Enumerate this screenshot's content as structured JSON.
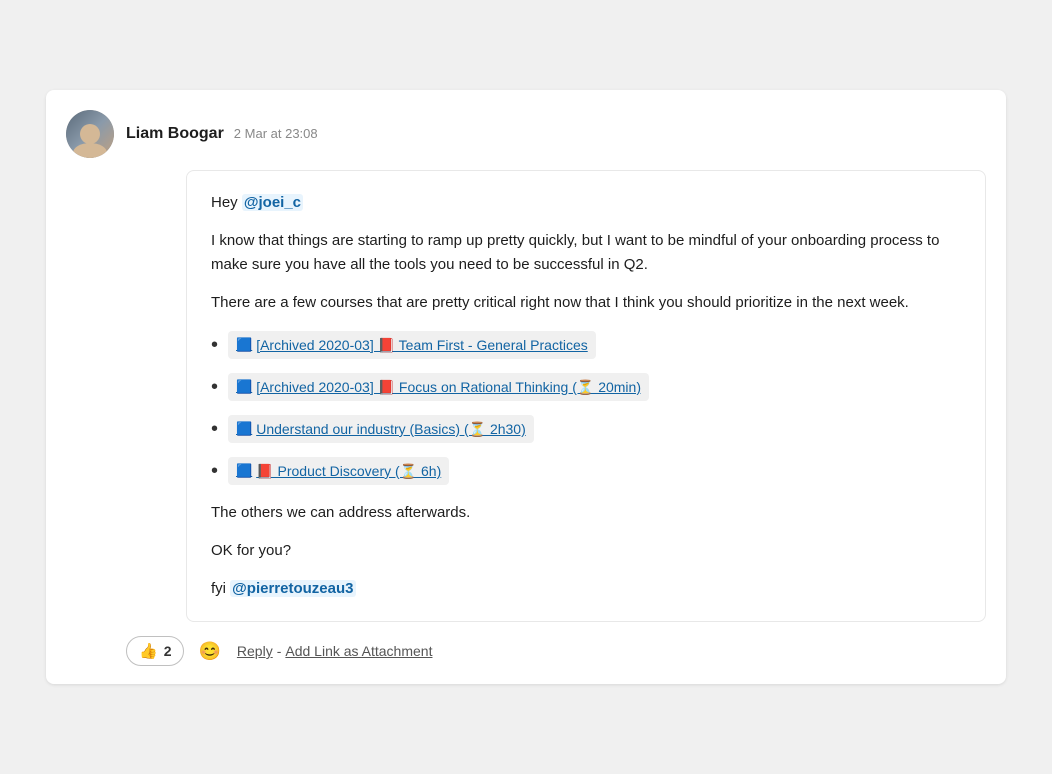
{
  "message": {
    "author": "Liam Boogar",
    "timestamp": "2 Mar at 23:08",
    "avatar_alt": "Liam Boogar avatar",
    "paragraphs": {
      "greeting": "Hey",
      "mention_joei": "@joei_c",
      "para1": "I know that things are starting to ramp up pretty quickly, but I want to be mindful of your onboarding process to make sure you have all the tools you need to be successful in Q2.",
      "para2": "There are a few courses that are pretty critical right now that I think you should prioritize in the next week.",
      "para3": "The others we can address afterwards.",
      "para4": "OK for you?",
      "fyi_label": "fyi",
      "mention_pierre": "@pierretouzeau3"
    },
    "courses": [
      {
        "icon1": "🟦",
        "icon2": "📕",
        "text": "[Archived 2020-03]📕  Team First - General Practices"
      },
      {
        "icon1": "🟦",
        "icon2": "📕",
        "text": "[Archived 2020-03]📕  Focus on Rational Thinking (⏳ 20min)"
      },
      {
        "icon1": "🟦",
        "text": "Understand our industry (Basics) (⏳ 2h30)"
      },
      {
        "icon1": "🟦",
        "icon2": "📕",
        "text": "Product Discovery (⏳ 6h)"
      }
    ]
  },
  "actions": {
    "reaction_emoji": "👍",
    "reaction_count": "2",
    "emoji_picker_label": "Add reaction",
    "reply_label": "Reply",
    "add_link_label": "Add Link as Attachment",
    "separator": " - "
  }
}
